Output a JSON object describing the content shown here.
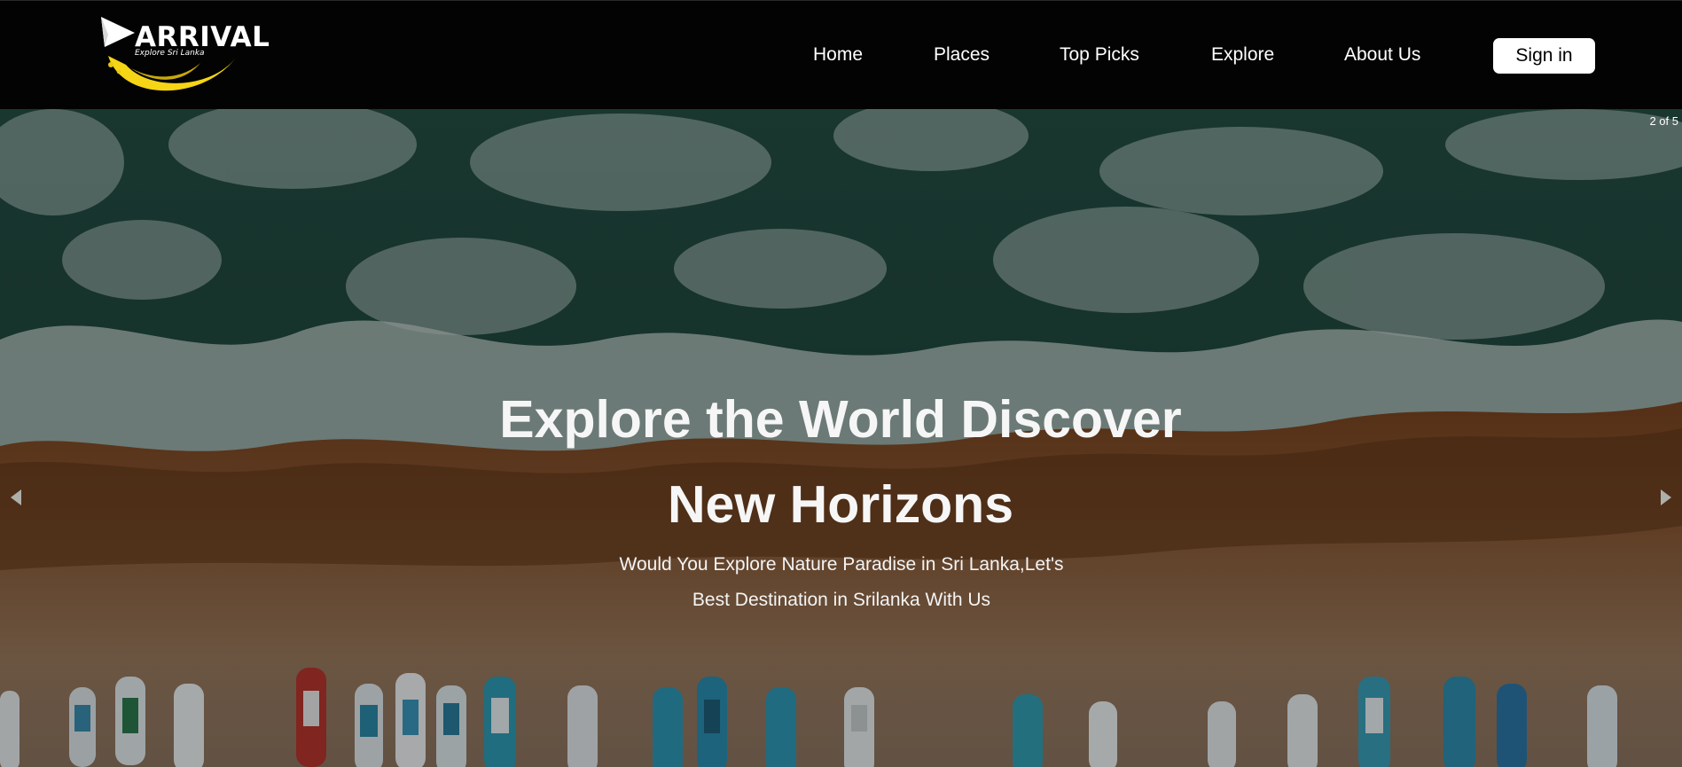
{
  "brand": {
    "name": "ARRIVAL",
    "tagline": "Explore Sri Lanka",
    "logo_colors": {
      "accent": "#f5d515",
      "dot": "#e8c911"
    }
  },
  "nav": {
    "items": [
      {
        "label": "Home"
      },
      {
        "label": "Places"
      },
      {
        "label": "Top Picks"
      },
      {
        "label": "Explore"
      },
      {
        "label": "About Us"
      }
    ],
    "signin_label": "Sign in"
  },
  "hero": {
    "counter": "2 of 5",
    "title_line1": "Explore the World Discover",
    "title_line2": "New Horizons",
    "subtitle_line1": "Would You Explore Nature Paradise in Sri Lanka,Let's",
    "subtitle_line2": "Best Destination in Srilanka With Us",
    "prev_icon": "chevron-left-icon",
    "next_icon": "chevron-right-icon"
  },
  "colors": {
    "navbar_bg": "#030303",
    "ocean": "#1f4a40",
    "foam": "#9fb5b0",
    "sand_wet": "#6b3e1d",
    "sand_dry": "#8a6a4e"
  }
}
